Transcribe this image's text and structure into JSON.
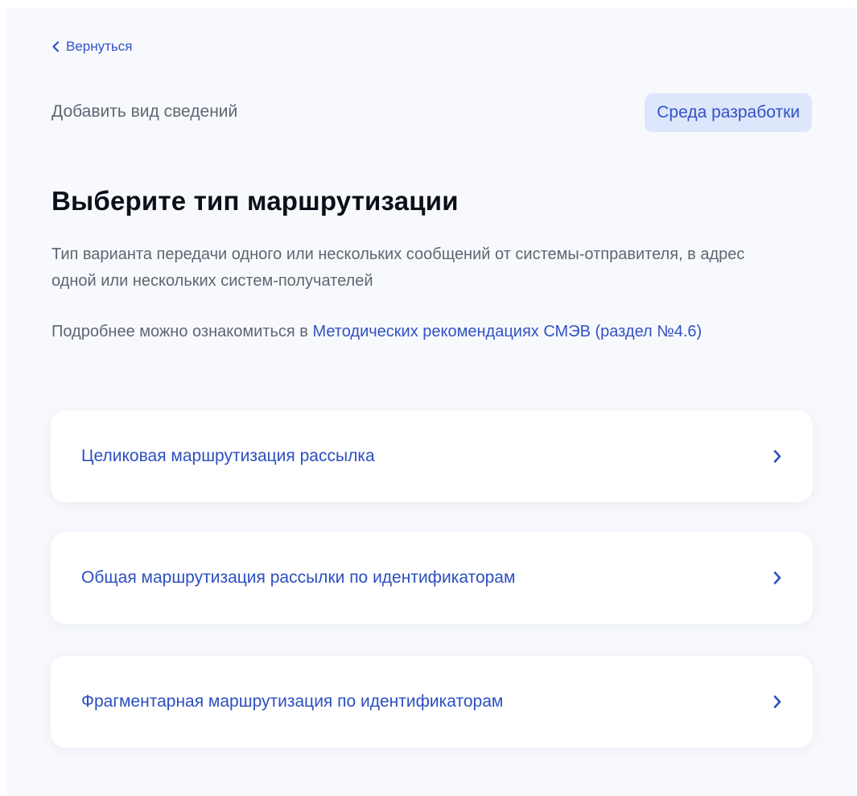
{
  "nav": {
    "back_label": "Вернуться"
  },
  "header": {
    "subtitle": "Добавить вид сведений",
    "env_badge": "Среда разработки"
  },
  "main": {
    "title": "Выберите тип маршрутизации",
    "description": "Тип варианта передачи одного или нескольких сообщений от системы-отправителя, в адрес одной или нескольких систем-получателей",
    "more_prefix": "Подробнее можно ознакомиться в ",
    "more_link": "Методических рекомендациях СМЭВ (раздел №4.6)",
    "options": [
      {
        "label": "Целиковая маршрутизация рассылка"
      },
      {
        "label": "Общая маршрутизация рассылки по идентификаторам"
      },
      {
        "label": "Фрагментарная маршрутизация по идентификаторам"
      }
    ]
  },
  "icons": {
    "back": "chevron-left-icon",
    "option": "chevron-right-icon"
  },
  "colors": {
    "accent": "#3152c5",
    "badge_bg": "#dde6fb",
    "page_bg": "#f8f9fd",
    "text_secondary": "#5e6673",
    "text_primary": "#0c0f19"
  }
}
